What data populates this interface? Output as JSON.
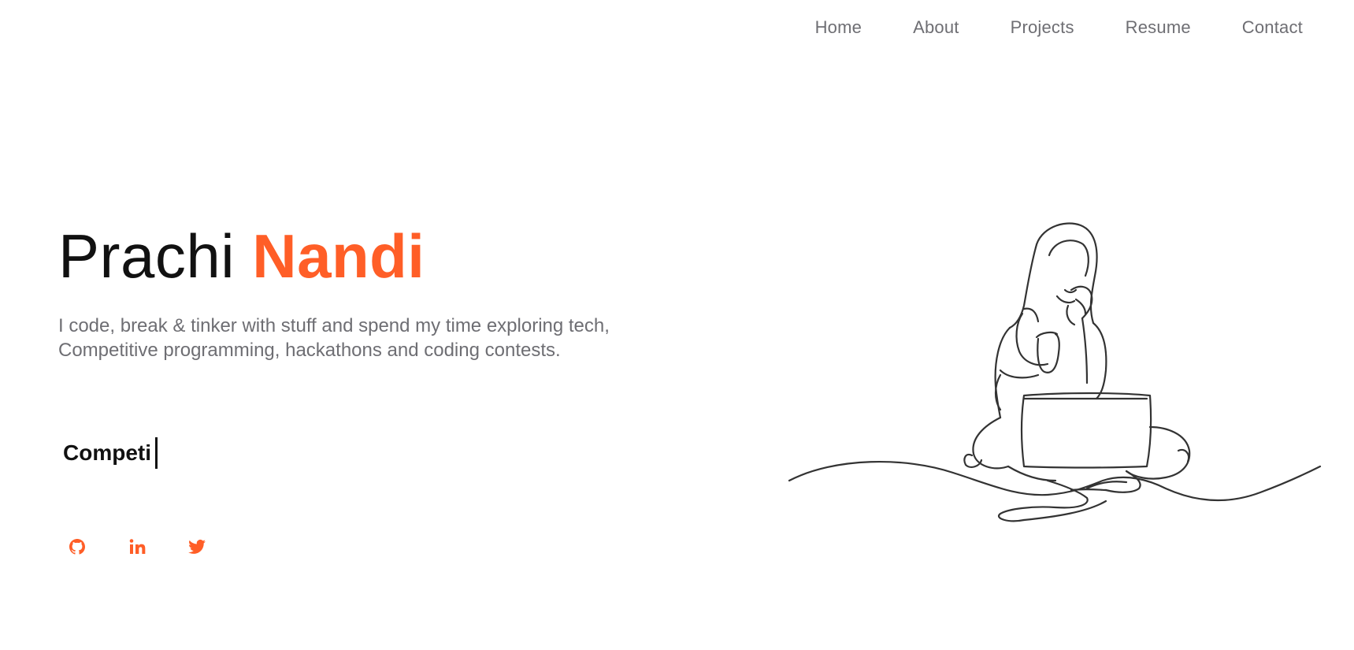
{
  "nav": {
    "items": [
      {
        "label": "Home"
      },
      {
        "label": "About"
      },
      {
        "label": "Projects"
      },
      {
        "label": "Resume"
      },
      {
        "label": "Contact"
      }
    ]
  },
  "hero": {
    "first_name": "Prachi",
    "last_name": "Nandi",
    "tagline_line1": "I code, break & tinker with stuff and spend my time exploring tech,",
    "tagline_line2": "Competitive programming, hackathons and coding contests.",
    "typed_text": "Competi"
  },
  "social": {
    "icons": [
      "github-icon",
      "linkedin-icon",
      "twitter-icon"
    ]
  },
  "colors": {
    "accent": "#ff5e27",
    "text": "#111111",
    "muted": "#6e6e73"
  }
}
